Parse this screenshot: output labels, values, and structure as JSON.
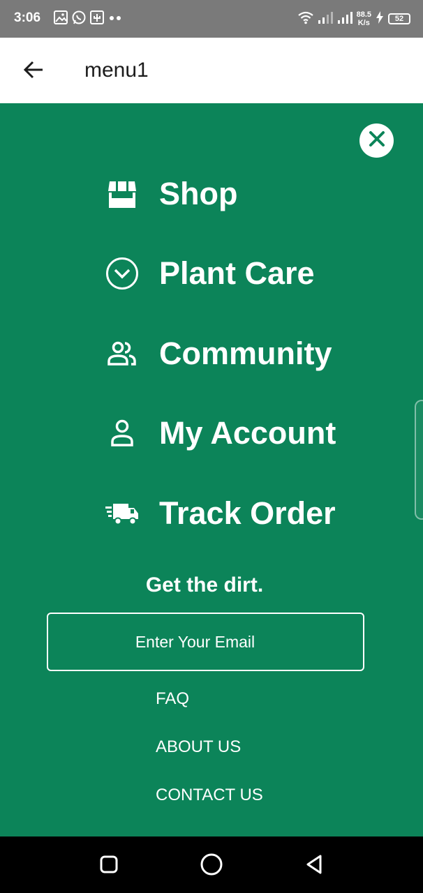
{
  "status_bar": {
    "time": "3:06",
    "left_icons": [
      "gallery-icon",
      "whatsapp-icon",
      "usb-icon",
      "more-dots-icon"
    ],
    "net_speed_value": "88.5",
    "net_speed_unit": "K/s",
    "battery_level": "52",
    "right_icons": [
      "wifi-icon",
      "signal-icon",
      "signal-icon",
      "charging-icon",
      "battery-icon"
    ]
  },
  "app_bar": {
    "title": "menu1",
    "back_icon": "arrow-left-icon"
  },
  "drawer": {
    "background_color": "#0c8459",
    "close_icon": "close-icon",
    "menu_items": [
      {
        "label": "Shop",
        "icon": "store-icon"
      },
      {
        "label": "Plant Care",
        "icon": "chevron-circle-icon"
      },
      {
        "label": "Community",
        "icon": "people-icon"
      },
      {
        "label": "My Account",
        "icon": "person-icon"
      },
      {
        "label": "Track Order",
        "icon": "delivery-truck-icon"
      }
    ],
    "newsletter": {
      "heading": "Get the dirt.",
      "email_placeholder": "Enter Your Email"
    },
    "footer_links": [
      {
        "label": "FAQ"
      },
      {
        "label": "ABOUT US"
      },
      {
        "label": "CONTACT US"
      }
    ]
  },
  "nav_bar": {
    "buttons": [
      "recents-icon",
      "home-icon",
      "back-triangle-icon"
    ]
  }
}
